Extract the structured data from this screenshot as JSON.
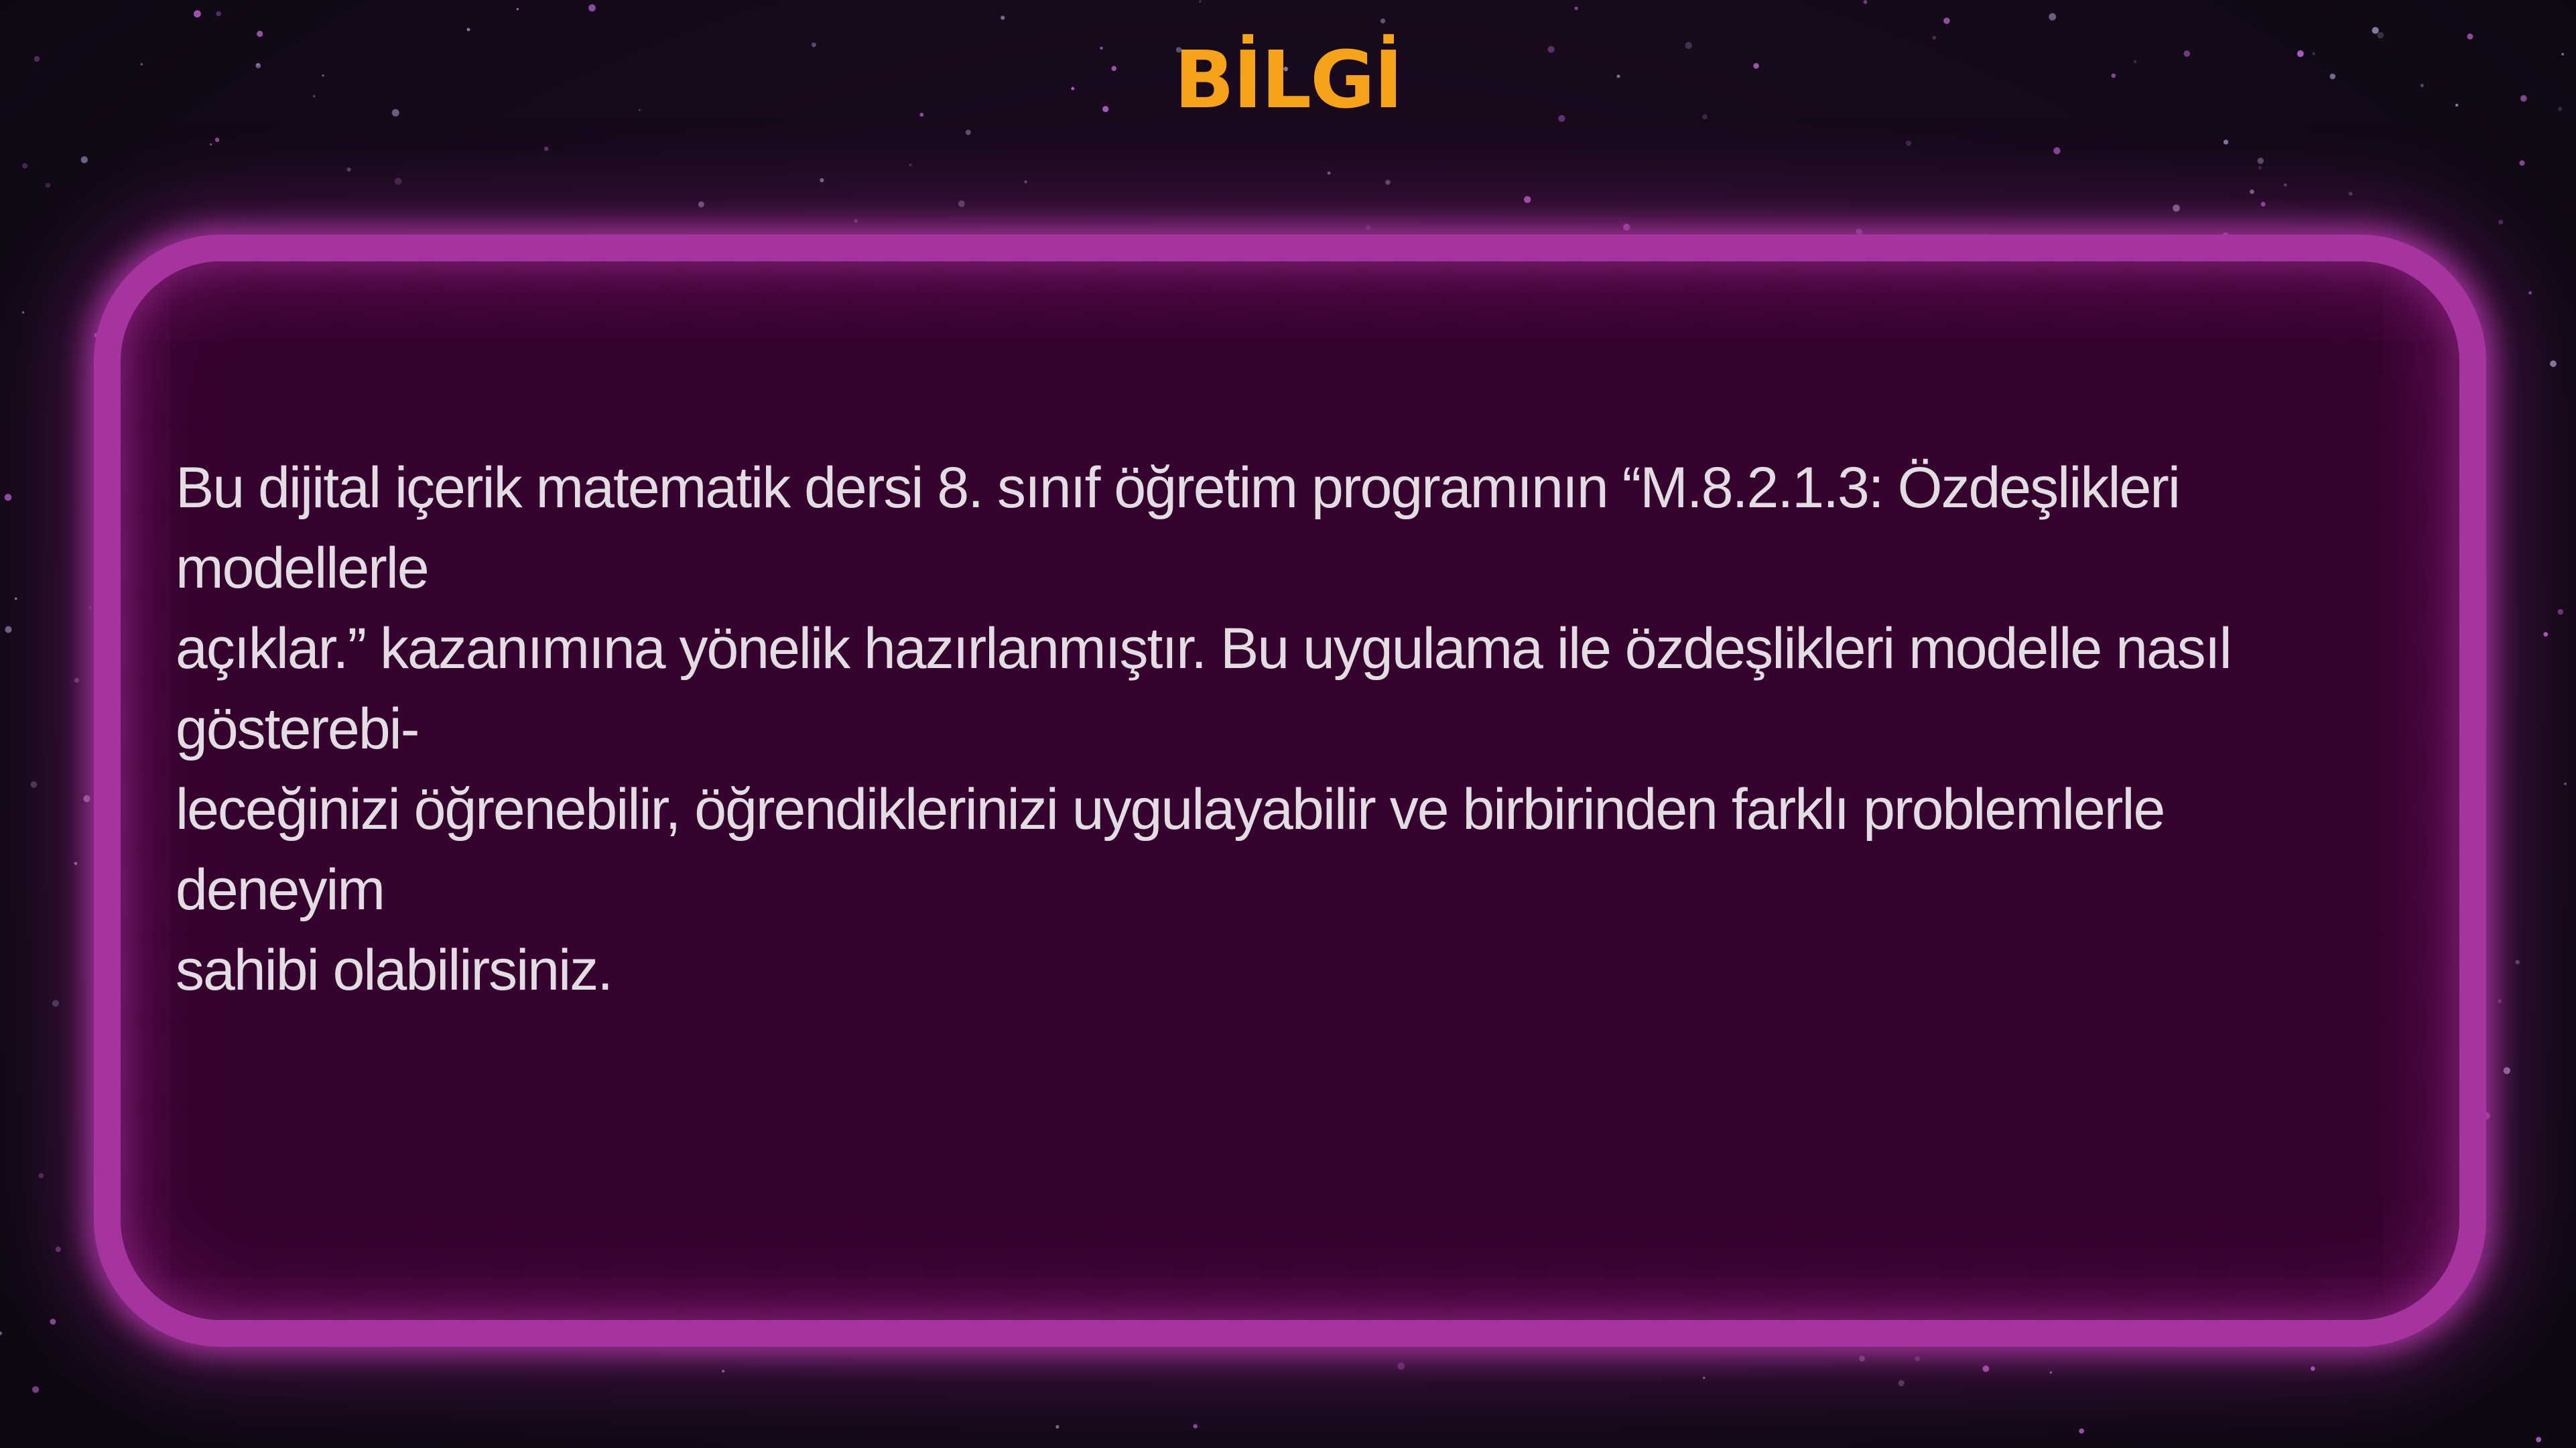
{
  "title": "BİLGİ",
  "info_text": "Bu dijital içerik matematik dersi 8. sınıf öğretim programının “M.8.2.1.3: Özdeşlikleri modellerle\naçıklar.” kazanımına yönelik hazırlanmıştır. Bu uygulama ile özdeşlikleri modelle nasıl gösterebi-\nleceğinizi öğrenebilir, öğrendiklerinizi uygulayabilir ve birbirinden farklı problemlerle deneyim\nsahibi olabilirsiniz.",
  "colors": {
    "title": "#f7a21b",
    "panel_border": "#a6349f",
    "panel_fill": "#36032e",
    "text": "#e2dde2",
    "background": "#120a18"
  }
}
